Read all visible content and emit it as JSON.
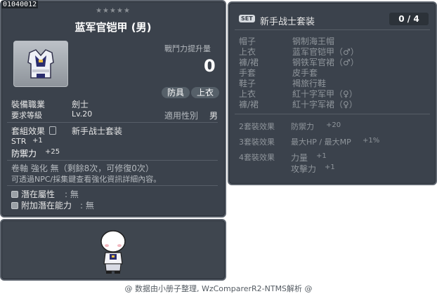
{
  "item_id": "01040012",
  "stars": "★★★★★",
  "item_name": "蓝军官铠甲 (男)",
  "power_up_label": "戰鬥力提升量",
  "power_up_value": "0",
  "tags": [
    "防具",
    "上衣"
  ],
  "job_label": "裝備職業",
  "job_value": "劍士",
  "req_level_label": "要求等級",
  "req_level_value": "Lv.20",
  "gender_label": "適用性別",
  "gender_value": "男",
  "set_effect_label": "套組效果",
  "set_effect_value": "新手战士套装",
  "stats": [
    {
      "name": "STR",
      "value": "+1"
    },
    {
      "name": "防禦力",
      "value": "+25"
    }
  ],
  "scroll_line": "卷軸 強化 無（剩餘8次，可修復0次）",
  "npc_line": "可透過NPC/採集鍵查看強化資訊詳細內容。",
  "potential_label": "潛在屬性",
  "potential_value": "無",
  "bonus_potential_label": "附加潛在能力",
  "bonus_potential_value": "無",
  "set": {
    "badge": "SET",
    "name": "新手战士套装",
    "count": "0 / 4",
    "pieces": [
      {
        "slot": "帽子",
        "name": "钢制海王帽"
      },
      {
        "slot": "上衣",
        "name": "蓝军官铠甲（♂）"
      },
      {
        "slot": "褲/裙",
        "name": "钢铁军官裙（♂）"
      },
      {
        "slot": "手套",
        "name": "皮手套"
      },
      {
        "slot": "鞋子",
        "name": "褐旅行鞋"
      },
      {
        "slot": "上衣",
        "name": "紅十字军甲（♀）"
      },
      {
        "slot": "褲/裙",
        "name": "紅十字军裙（♀）"
      }
    ],
    "effects": [
      {
        "label": "2套裝效果",
        "lines": [
          {
            "stat": "防禦力",
            "value": "+20"
          }
        ]
      },
      {
        "label": "3套裝效果",
        "lines": [
          {
            "stat": "最大HP / 最大MP",
            "value": "+1%"
          }
        ]
      },
      {
        "label": "4套裝效果",
        "lines": [
          {
            "stat": "力量",
            "value": "+1"
          },
          {
            "stat": "攻擊力",
            "value": "+1"
          }
        ]
      }
    ]
  },
  "footer": "@ 数据由小册子整理, WzComparerR2-NTMS解析 @",
  "colors": {
    "panel_bg": "#3b424c",
    "panel_border": "#5b626c",
    "text": "#e6e6e6",
    "muted": "#8f959b"
  }
}
